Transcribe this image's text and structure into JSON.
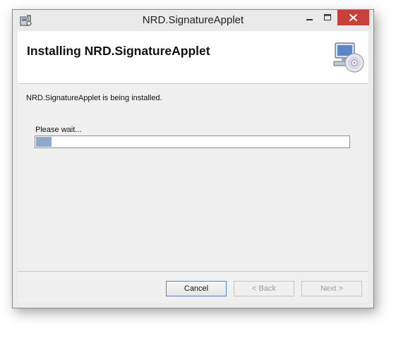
{
  "window": {
    "title": "NRD.SignatureApplet"
  },
  "titlebar_controls": [
    "minimize-icon",
    "maximize-icon",
    "close-icon"
  ],
  "header": {
    "title": "Installing NRD.SignatureApplet",
    "icon": "computer-cd-icon"
  },
  "content": {
    "status_text": "NRD.SignatureApplet is being installed.",
    "wait_text": "Please wait...",
    "progress_fraction": 0.05
  },
  "buttons": {
    "cancel": "Cancel",
    "back": "< Back",
    "next": "Next >"
  },
  "colors": {
    "close_button": "#c7413a",
    "progress_fill": "#8ea9c9",
    "focused_button_border": "#4f88c6"
  }
}
